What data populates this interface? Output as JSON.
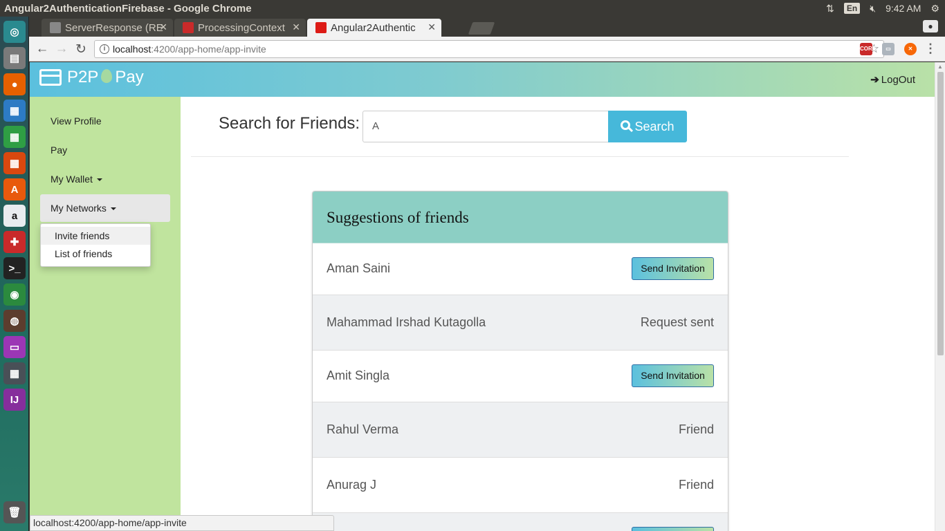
{
  "window": {
    "title": "Angular2AuthenticationFirebase - Google Chrome",
    "lang": "En",
    "time": "9:42 AM"
  },
  "tabs": [
    {
      "label": "ServerResponse (RE",
      "icon": "jboss-icon",
      "active": false
    },
    {
      "label": "ProcessingContext",
      "icon": "oracle-icon",
      "active": false
    },
    {
      "label": "Angular2Authentic",
      "icon": "angular-icon",
      "active": true
    }
  ],
  "address": {
    "host": "localhost",
    "path": ":4200/app-home/app-invite"
  },
  "extensions": {
    "cors": "CORS"
  },
  "app": {
    "brand_left": "P2P",
    "brand_right": "Pay",
    "logout": "LogOut"
  },
  "sidebar": {
    "items": [
      {
        "label": "View Profile"
      },
      {
        "label": "Pay"
      },
      {
        "label": "My Wallet"
      },
      {
        "label": "My Networks"
      }
    ],
    "dropdown": [
      "Invite friends",
      "List of friends"
    ]
  },
  "search": {
    "label": "Search for Friends:",
    "value": "A",
    "button": "Search"
  },
  "panel": {
    "title": "Suggestions of friends",
    "rows": [
      {
        "name": "Aman Saini",
        "action": "Send Invitation"
      },
      {
        "name": "Mahammad Irshad Kutagolla",
        "status": "Request sent"
      },
      {
        "name": "Amit Singla",
        "action": "Send Invitation"
      },
      {
        "name": "Rahul Verma",
        "status": "Friend"
      },
      {
        "name": "Anurag J",
        "status": "Friend"
      }
    ]
  },
  "statusbar": "localhost:4200/app-home/app-invite",
  "colors": {
    "nav_start": "#5bc0de",
    "nav_end": "#b9e1a7",
    "sidebar": "#c0e49e",
    "panel_head": "#8ccfc4",
    "search_button": "#46b8da"
  }
}
